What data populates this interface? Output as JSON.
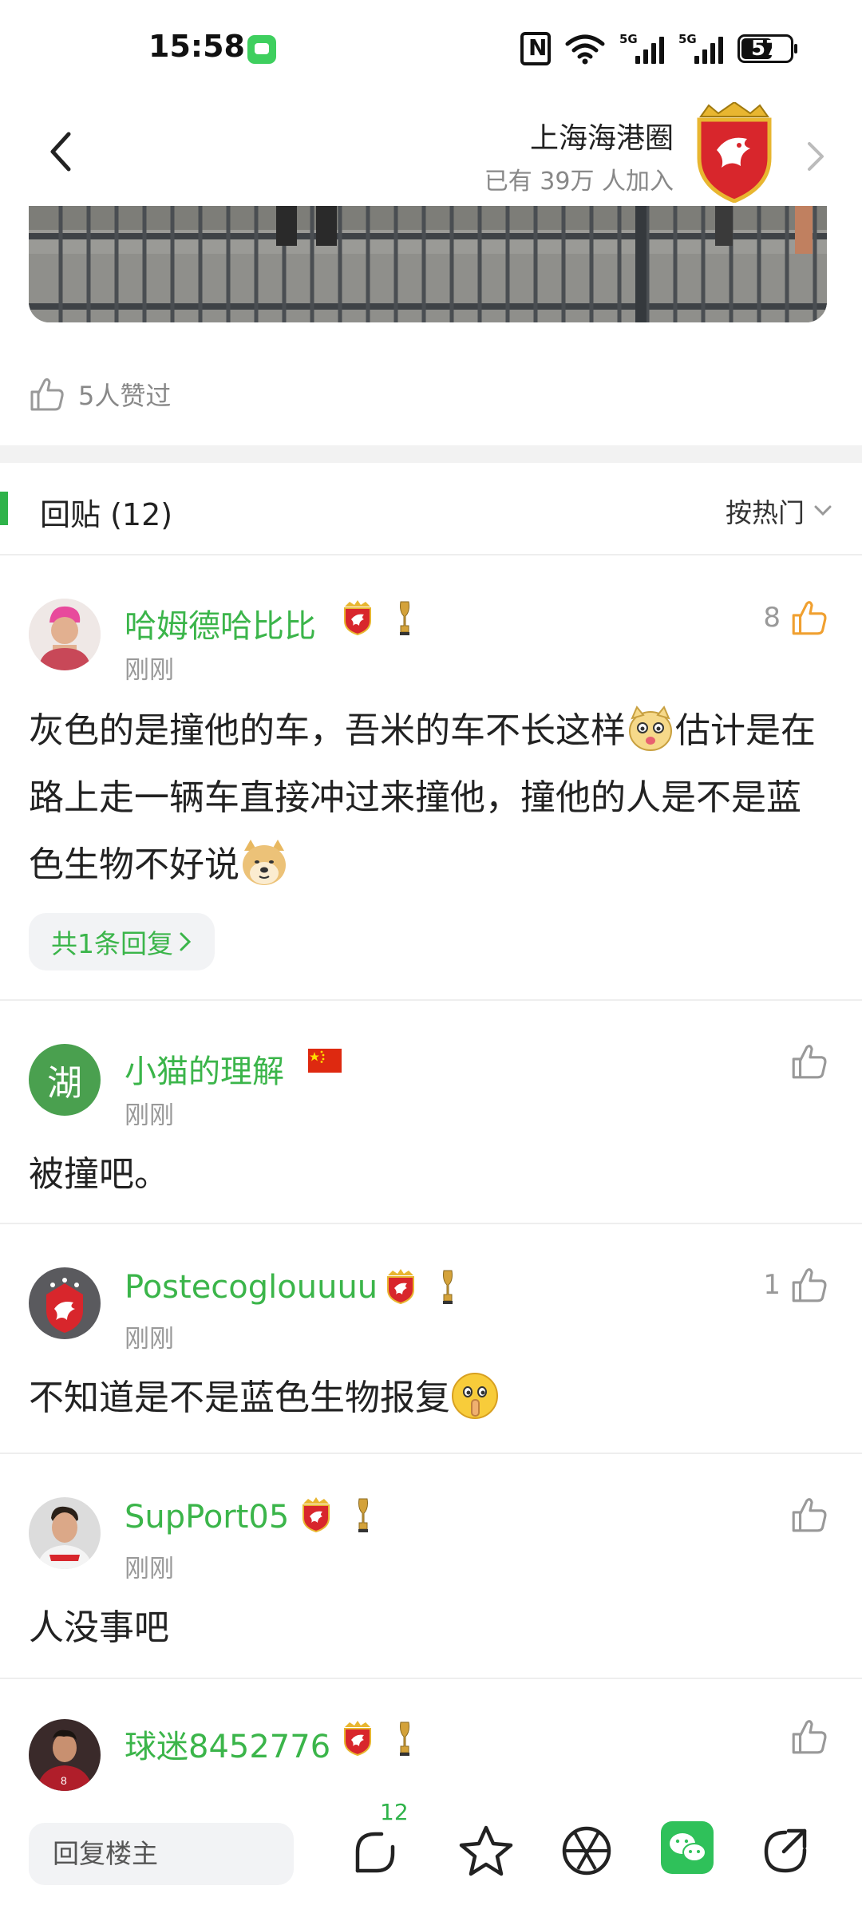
{
  "status_bar": {
    "time": "15:58",
    "network_1": "5G",
    "network_2": "5G",
    "battery": "57"
  },
  "header": {
    "circle_name": "上海海港圈",
    "members": "已有 39万 人加入"
  },
  "post": {
    "likes_text": "5人赞过"
  },
  "replies": {
    "title": "回贴 (12)",
    "sort_label": "按热门"
  },
  "comments": [
    {
      "username": "哈姆德哈比比",
      "time": "刚刚",
      "text_parts": [
        "灰色的是撞他的车，吾米的车不长这样",
        "估计是在路上走一辆车直接冲过来撞他，撞他的人是不是蓝色生物不好说"
      ],
      "likes": "8",
      "sub_replies": "共1条回复"
    },
    {
      "username": "小猫的理解",
      "avatar_text": "湖",
      "time": "刚刚",
      "text": "被撞吧。",
      "likes": ""
    },
    {
      "username": "Postecoglouuuu",
      "time": "刚刚",
      "text": "不知道是不是蓝色生物报复",
      "likes": "1"
    },
    {
      "username": "SupPort05",
      "time": "刚刚",
      "text": "人没事吧",
      "likes": ""
    },
    {
      "username": "球迷8452776",
      "time": "",
      "text": "",
      "likes": ""
    }
  ],
  "bottom_bar": {
    "reply_placeholder": "回复楼主",
    "comment_count": "12"
  },
  "colors": {
    "accent_green": "#3bb54a",
    "like_orange": "#f0a030",
    "muted_gray": "#999999"
  },
  "icons": [
    "back-arrow-icon",
    "forward-arrow-icon",
    "thumbs-up-icon",
    "chevron-down-icon",
    "club-badge-icon",
    "trophy-icon",
    "china-flag-icon",
    "comment-bubble-icon",
    "star-icon",
    "aperture-icon",
    "wechat-icon",
    "share-icon"
  ]
}
